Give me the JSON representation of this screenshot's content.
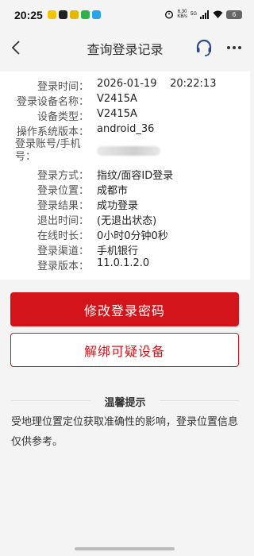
{
  "status_bar": {
    "time": "20:25",
    "net_speed_value": "6.30",
    "net_speed_unit": "KB/s",
    "signal": "5G",
    "battery": "6"
  },
  "header": {
    "title": "查询登录记录"
  },
  "record": {
    "rows": [
      {
        "label": "登录时间：",
        "value": "2026-01-19    20:22:13"
      },
      {
        "label": "登录设备名称：",
        "value": "V2415A"
      },
      {
        "label": "设备类型：",
        "value": "V2415A"
      },
      {
        "label": "操作系统版本：",
        "value": "android_36"
      },
      {
        "label": "登录账号/手机号：",
        "value": ""
      },
      {
        "label": "登录方式：",
        "value": "指纹/面容ID登录"
      },
      {
        "label": "登录位置：",
        "value": "成都市"
      },
      {
        "label": "登录结果：",
        "value": "成功登录"
      },
      {
        "label": "退出时间：",
        "value": "(无退出状态)"
      },
      {
        "label": "在线时长：",
        "value": "0小时0分钟0秒"
      },
      {
        "label": "登录渠道：",
        "value": "手机银行"
      },
      {
        "label": "登录版本：",
        "value": "11.0.1.2.0"
      }
    ]
  },
  "actions": {
    "change_password": "修改登录密码",
    "unbind_device": "解绑可疑设备"
  },
  "tips": {
    "title": "温馨提示",
    "text": "受地理位置定位获取准确性的影响，登录位置信息仅供参考。"
  },
  "colors": {
    "brand_red": "#d3151b",
    "background": "#f4f4f4"
  },
  "icons": [
    "back-arrow-icon",
    "customer-service-icon",
    "more-icon",
    "alarm-icon",
    "wifi-icon",
    "signal-icon",
    "battery-icon"
  ]
}
